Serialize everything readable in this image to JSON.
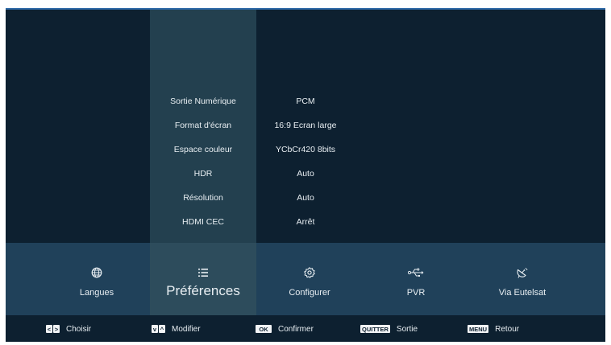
{
  "settings": [
    {
      "label": "Sortie Numérique",
      "value": "PCM"
    },
    {
      "label": "Format d'écran",
      "value": "16:9 Ecran large"
    },
    {
      "label": "Espace couleur",
      "value": "YCbCr420 8bits"
    },
    {
      "label": "HDR",
      "value": "Auto"
    },
    {
      "label": "Résolution",
      "value": "Auto"
    },
    {
      "label": "HDMI CEC",
      "value": "Arrêt"
    }
  ],
  "menu": [
    {
      "label": "Langues",
      "icon": "globe-icon"
    },
    {
      "label": "Préférences",
      "icon": "list-icon",
      "active": true
    },
    {
      "label": "Configurer",
      "icon": "settings-gear-icon"
    },
    {
      "label": "PVR",
      "icon": "usb-icon"
    },
    {
      "label": "Via Eutelsat",
      "icon": "satellite-dish-icon"
    }
  ],
  "footer": {
    "choose_keys": [
      "<",
      ">"
    ],
    "choose_label": "Choisir",
    "modify_keys": [
      "v",
      "^"
    ],
    "modify_label": "Modifier",
    "confirm_key": "OK",
    "confirm_label": "Confirmer",
    "quit_key": "QUITTER",
    "quit_label": "Sortie",
    "menu_key": "MENU",
    "menu_label": "Retour"
  },
  "colors": {
    "background": "#0d2030",
    "highlight_column": "#23404f",
    "bottom_bar": "#20415a",
    "active_item": "#2d4c5c",
    "accent_line": "#2f6aa8",
    "text": "#e8eef2"
  }
}
